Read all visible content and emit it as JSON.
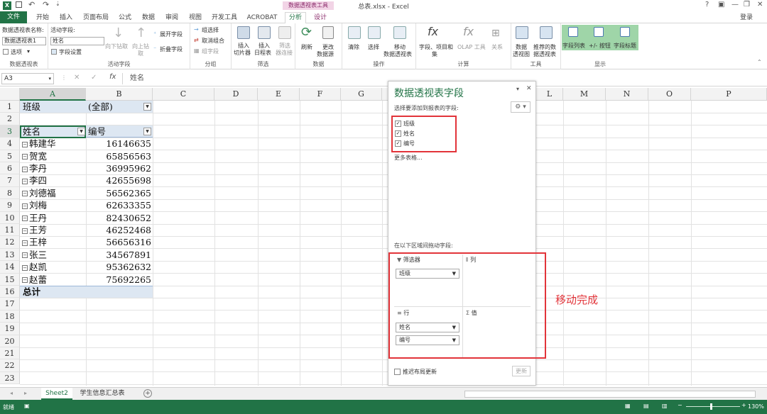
{
  "window": {
    "title": "总表.xlsx - Excel",
    "context_tools": "数据透视表工具",
    "signin": "登录",
    "help": "?"
  },
  "tabs": [
    "文件",
    "开始",
    "插入",
    "页面布局",
    "公式",
    "数据",
    "审阅",
    "视图",
    "开发工具",
    "ACROBAT",
    "分析",
    "设计"
  ],
  "ribbon": {
    "pivot_name_label": "数据透视表名称:",
    "pivot_name_value": "数据透视表1",
    "options_label": "选项",
    "active_field_label": "活动字段:",
    "active_field_value": "姓名",
    "field_settings_label": "字段设置",
    "drill_down": "向下钻取",
    "drill_up_a": "向上钻",
    "drill_up_b": "取",
    "expand_field": "展开字段",
    "collapse_field": "折叠字段",
    "group_selection": "组选择",
    "ungroup": "取消组合",
    "group_field": "组字段",
    "insert_slicer_a": "插入",
    "insert_slicer_b": "切片器",
    "insert_timeline_a": "插入",
    "insert_timeline_b": "日程表",
    "filter_conn_a": "筛选",
    "filter_conn_b": "器连接",
    "refresh": "刷新",
    "change_source_a": "更改",
    "change_source_b": "数据源",
    "clear": "清除",
    "select": "选择",
    "move_a": "移动",
    "move_b": "数据透视表",
    "fields_items_a": "字段、项目和",
    "fields_items_b": "集",
    "olap": "OLAP 工具",
    "relations": "关系",
    "pivot_chart_a": "数据",
    "pivot_chart_b": "透视图",
    "recommended_a": "推荐的数",
    "recommended_b": "据透视表",
    "field_list": "字段列表",
    "buttons": "+/- 按钮",
    "field_headers": "字段标题",
    "groups": {
      "pivot": "数据透视表",
      "active_field": "活动字段",
      "group": "分组",
      "filter": "筛选",
      "data": "数据",
      "actions": "操作",
      "calc": "计算",
      "tools": "工具",
      "show": "显示"
    }
  },
  "formula_bar": {
    "name_box": "A3",
    "fx": "fx",
    "content": "姓名"
  },
  "columns": [
    "A",
    "B",
    "C",
    "D",
    "E",
    "F",
    "G",
    "H",
    "L",
    "M",
    "N",
    "O",
    "P"
  ],
  "rows": [
    "1",
    "2",
    "3",
    "4",
    "5",
    "6",
    "7",
    "8",
    "9",
    "10",
    "11",
    "12",
    "13",
    "14",
    "15",
    "16",
    "17",
    "18",
    "19",
    "20",
    "21",
    "22",
    "23"
  ],
  "pivot": {
    "filter_label": "班级",
    "filter_value": "(全部)",
    "header_name": "姓名",
    "header_id": "编号",
    "names": [
      "韩建华",
      "贺宽",
      "李丹",
      "李四",
      "刘德福",
      "刘梅",
      "王丹",
      "王芳",
      "王梓",
      "张三",
      "赵凯",
      "赵蕾"
    ],
    "ids": [
      "16146635",
      "65856563",
      "36995962",
      "42655698",
      "56562365",
      "62633355",
      "82430652",
      "46252468",
      "56656316",
      "34567891",
      "95362632",
      "75692265"
    ],
    "total": "总计"
  },
  "pane": {
    "title": "数据透视表字段",
    "choose_label": "选择要添加到报表的字段:",
    "fields": [
      "班级",
      "姓名",
      "编号"
    ],
    "more_tables": "更多表格...",
    "drag_label": "在以下区域间拖动字段:",
    "filters_title": "筛选器",
    "columns_title": "列",
    "rows_title": "行",
    "values_title": "值",
    "filter_item": "班级",
    "row_items": [
      "姓名",
      "编号"
    ],
    "defer_label": "推迟布局更新",
    "update_button": "更新"
  },
  "annotation": "移动完成",
  "sheets": [
    "Sheet2",
    "学生信息汇总表"
  ],
  "status": {
    "ready": "就绪",
    "zoom": "130%"
  },
  "colors": {
    "excel_green": "#217346",
    "annotation_red": "#e2343a",
    "pane_title": "#217346"
  }
}
